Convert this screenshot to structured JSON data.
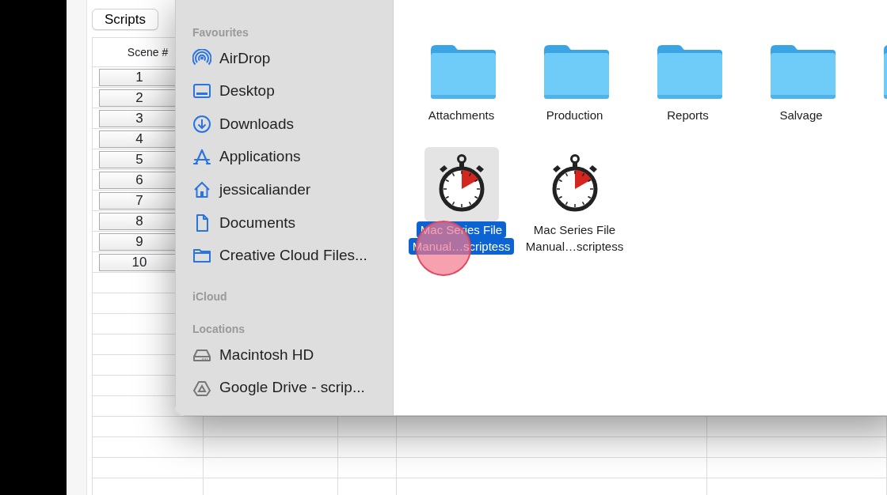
{
  "background_app": {
    "scripts_button": "Scripts",
    "table": {
      "columns": [
        "Scene #"
      ],
      "rows": [
        "1",
        "2",
        "3",
        "4",
        "5",
        "6",
        "7",
        "8",
        "9",
        "10"
      ]
    }
  },
  "dialog": {
    "sidebar": [
      {
        "title": "Favourites",
        "items": [
          {
            "label": "AirDrop"
          },
          {
            "label": "Desktop"
          },
          {
            "label": "Downloads"
          },
          {
            "label": "Applications"
          },
          {
            "label": "jessicaliander"
          },
          {
            "label": "Documents"
          },
          {
            "label": "Creative Cloud Files..."
          }
        ]
      },
      {
        "title": "iCloud"
      },
      {
        "title": "Locations",
        "items": [
          {
            "label": "Macintosh HD"
          },
          {
            "label": "Google Drive - scrip..."
          }
        ]
      }
    ],
    "files": [
      {
        "kind": "folder",
        "label_lines": [
          "Attachments"
        ],
        "selected": false
      },
      {
        "kind": "folder",
        "label_lines": [
          "Production"
        ],
        "selected": false
      },
      {
        "kind": "folder",
        "label_lines": [
          "Reports"
        ],
        "selected": false
      },
      {
        "kind": "folder",
        "label_lines": [
          "Salvage"
        ],
        "selected": false
      },
      {
        "kind": "folder",
        "selected": false
      },
      {
        "kind": "stopwatch",
        "label_lines": [
          "Mac Series File",
          "Manual…scriptess"
        ],
        "selected": true
      },
      {
        "kind": "stopwatch",
        "label_lines": [
          "Mac Series File",
          "Manual…scriptess"
        ],
        "selected": false
      }
    ]
  }
}
